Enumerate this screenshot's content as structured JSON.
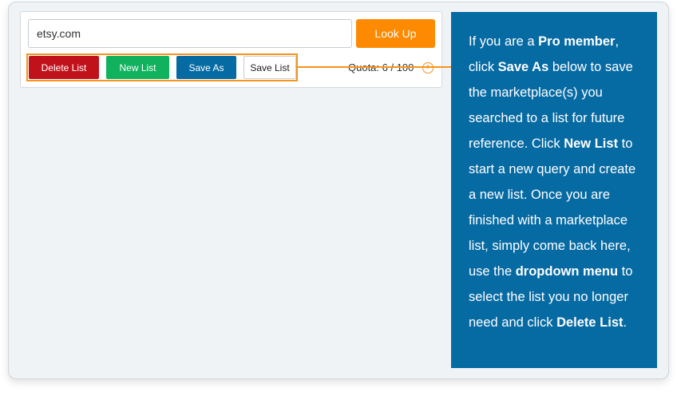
{
  "search": {
    "value": "etsy.com",
    "button_label": "Look Up"
  },
  "list_actions": {
    "delete_label": "Delete List",
    "new_label": "New List",
    "save_as_label": "Save As",
    "save_list_label": "Save List"
  },
  "quota": {
    "text": "Quota: 6 / 100",
    "icon": "plus-circle-icon"
  },
  "tooltip": {
    "segments": [
      {
        "text": "If you are a ",
        "bold": false
      },
      {
        "text": "Pro member",
        "bold": true
      },
      {
        "text": ", click ",
        "bold": false
      },
      {
        "text": "Save As",
        "bold": true
      },
      {
        "text": " below to save the marketplace(s) you searched to a list for future reference. Click ",
        "bold": false
      },
      {
        "text": "New List",
        "bold": true
      },
      {
        "text": " to start a new query and create a new list. Once you are finished with a marketplace list, simply come back here, use the ",
        "bold": false
      },
      {
        "text": "dropdown menu",
        "bold": true
      },
      {
        "text": " to select the list you no longer need and click ",
        "bold": false
      },
      {
        "text": "Delete List",
        "bold": true
      },
      {
        "text": ".",
        "bold": false
      }
    ]
  },
  "colors": {
    "accent_orange": "#f7941d",
    "lookup_orange": "#fd8a00",
    "delete_red": "#c1121b",
    "new_green": "#10b25e",
    "save_blue": "#066aa3"
  }
}
